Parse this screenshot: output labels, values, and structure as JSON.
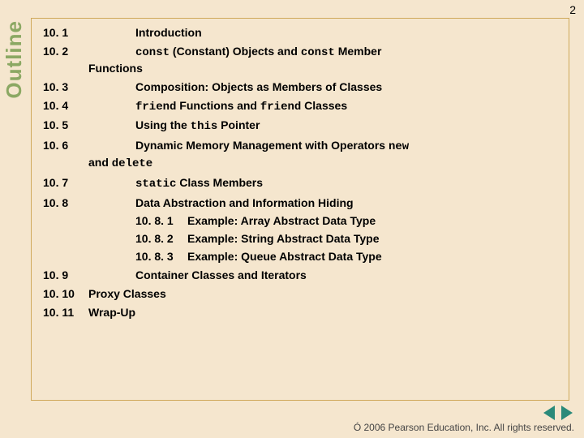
{
  "page_number": "2",
  "sidebar_label": "Outline",
  "items": [
    {
      "num": "10. 1",
      "title_parts": [
        {
          "t": "Introduction"
        }
      ]
    },
    {
      "num": "10. 2",
      "title_parts": [
        {
          "t": "const",
          "mono": true
        },
        {
          "t": " (Constant) Objects and "
        },
        {
          "t": "const",
          "mono": true
        },
        {
          "t": " Member"
        }
      ],
      "wrap": "Functions"
    },
    {
      "num": "10. 3",
      "title_parts": [
        {
          "t": "Composition: Objects as Members of Classes"
        }
      ]
    },
    {
      "num": "10. 4",
      "title_parts": [
        {
          "t": "friend",
          "mono": true
        },
        {
          "t": " Functions and "
        },
        {
          "t": "friend",
          "mono": true
        },
        {
          "t": " Classes"
        }
      ]
    },
    {
      "num": "10. 5",
      "title_parts": [
        {
          "t": "Using the "
        },
        {
          "t": "this",
          "mono": true
        },
        {
          "t": " Pointer"
        }
      ]
    },
    {
      "num": "10. 6",
      "title_parts": [
        {
          "t": "Dynamic Memory Management with Operators "
        },
        {
          "t": "new",
          "mono": true
        }
      ],
      "wrap_parts": [
        {
          "t": "and "
        },
        {
          "t": "delete",
          "mono": true
        }
      ]
    },
    {
      "num": "10. 7",
      "title_parts": [
        {
          "t": "static",
          "mono": true
        },
        {
          "t": " Class Members"
        }
      ]
    },
    {
      "num": "10. 8",
      "title_parts": [
        {
          "t": "Data Abstraction and Information Hiding"
        }
      ],
      "subs": [
        {
          "num": "10. 8. 1",
          "title": "Example: Array Abstract Data Type"
        },
        {
          "num": "10. 8. 2",
          "title": "Example: String Abstract Data Type"
        },
        {
          "num": "10. 8. 3",
          "title": "Example: Queue Abstract Data Type"
        }
      ]
    },
    {
      "num": "10. 9",
      "title_parts": [
        {
          "t": "Container Classes and Iterators"
        }
      ]
    },
    {
      "num": "10. 10",
      "title_parts": [
        {
          "t": "Proxy Classes"
        }
      ],
      "noindent": true
    },
    {
      "num": "10. 11",
      "title_parts": [
        {
          "t": "Wrap-Up"
        }
      ],
      "noindent": true
    }
  ],
  "footer": "Ó 2006 Pearson Education, Inc.  All rights reserved."
}
